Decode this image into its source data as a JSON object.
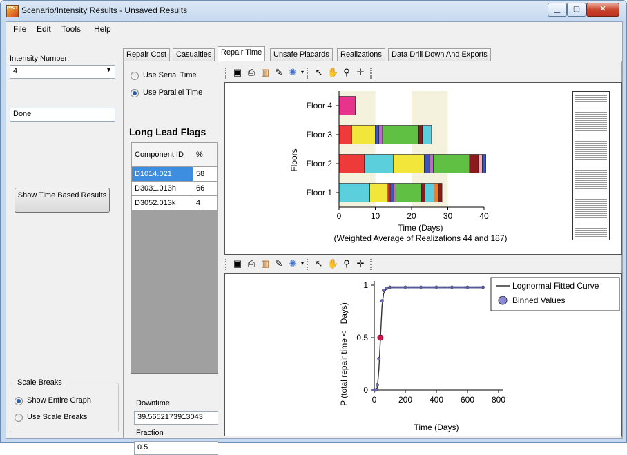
{
  "window": {
    "title": "Scenario/Intensity Results - Unsaved Results",
    "app_icon_text": "PACT"
  },
  "menu": [
    "File",
    "Edit",
    "Tools",
    "Help"
  ],
  "left": {
    "intensity_label": "Intensity Number:",
    "intensity_value": "4",
    "status": "Done",
    "show_time_button": "Show Time Based Results",
    "scale_breaks": {
      "legend": "Scale Breaks",
      "show_entire": "Show Entire Graph",
      "use_scale": "Use Scale Breaks",
      "selected": "show_entire"
    }
  },
  "tabs": [
    "Repair Cost",
    "Casualties",
    "Repair Time",
    "Unsafe Placards",
    "Realizations",
    "Data Drill Down And Exports"
  ],
  "active_tab": "Repair Time",
  "repair_time": {
    "use_serial": "Use Serial Time",
    "use_parallel": "Use Parallel Time",
    "selected": "parallel",
    "flags_title": "Long Lead Flags",
    "flags_headers": [
      "Component ID",
      "%"
    ],
    "flags_rows": [
      {
        "id": "D1014.021",
        "pct": "58"
      },
      {
        "id": "D3031.013h",
        "pct": "66"
      },
      {
        "id": "D3052.013k",
        "pct": "4"
      }
    ],
    "downtime_label": "Downtime",
    "downtime_value": "39.5652173913043",
    "fraction_label": "Fraction",
    "fraction_value": "0.5"
  },
  "toolbar_icons": [
    "chart-type-icon",
    "print-icon",
    "chart-data-icon",
    "chart-wizard-icon",
    "palette-icon",
    "pointer-icon",
    "pan-icon",
    "zoom-icon",
    "crosshair-icon"
  ],
  "chart_data": [
    {
      "type": "bar",
      "orientation": "horizontal-stacked",
      "ylabel": "Floors",
      "xlabel": "Time (Days)",
      "subtitle": "(Weighted Average of Realizations 44 and 187)",
      "categories": [
        "Floor 1",
        "Floor 2",
        "Floor 3",
        "Floor 4"
      ],
      "xlim": [
        0,
        40
      ],
      "xticks": [
        0,
        10,
        20,
        30,
        40
      ],
      "segments": {
        "Floor 1": [
          {
            "v": 8.5,
            "c": "#5bcfdc"
          },
          {
            "v": 5,
            "c": "#f2e63a"
          },
          {
            "v": 0.6,
            "c": "#ef3a3a"
          },
          {
            "v": 1,
            "c": "#3c55b8"
          },
          {
            "v": 0.6,
            "c": "#b96cc9"
          },
          {
            "v": 7,
            "c": "#5fc043"
          },
          {
            "v": 1,
            "c": "#8b1a1a"
          },
          {
            "v": 2.5,
            "c": "#5bcfdc"
          },
          {
            "v": 1.2,
            "c": "#f07f22"
          },
          {
            "v": 1,
            "c": "#8b1a1a"
          }
        ],
        "Floor 2": [
          {
            "v": 7,
            "c": "#ef3a3a"
          },
          {
            "v": 8,
            "c": "#5bcfdc"
          },
          {
            "v": 8.5,
            "c": "#f2e63a"
          },
          {
            "v": 1.5,
            "c": "#3c55b8"
          },
          {
            "v": 1,
            "c": "#b96cc9"
          },
          {
            "v": 10,
            "c": "#5fc043"
          },
          {
            "v": 2.5,
            "c": "#8b1a1a"
          },
          {
            "v": 1,
            "c": "#f7a9b8"
          },
          {
            "v": 1,
            "c": "#3c55b8"
          }
        ],
        "Floor 3": [
          {
            "v": 3.5,
            "c": "#ef3a3a"
          },
          {
            "v": 6.5,
            "c": "#f2e63a"
          },
          {
            "v": 1,
            "c": "#3c55b8"
          },
          {
            "v": 1,
            "c": "#b96cc9"
          },
          {
            "v": 10,
            "c": "#5fc043"
          },
          {
            "v": 1,
            "c": "#8b1a1a"
          },
          {
            "v": 2.5,
            "c": "#5bcfdc"
          }
        ],
        "Floor 4": [
          {
            "v": 4.5,
            "c": "#e8338c"
          }
        ]
      }
    },
    {
      "type": "line",
      "xlabel": "Time (Days)",
      "ylabel": "P (total repair time <= Days)",
      "xlim": [
        0,
        800
      ],
      "xticks": [
        0,
        200,
        400,
        600,
        800
      ],
      "ylim": [
        0,
        1
      ],
      "yticks": [
        0,
        0.5,
        1
      ],
      "series": [
        {
          "name": "Lognormal Fitted Curve",
          "x": [
            0,
            20,
            30,
            35,
            40,
            45,
            50,
            60,
            80,
            100,
            200,
            400,
            600,
            700
          ],
          "y": [
            0,
            0.02,
            0.2,
            0.35,
            0.5,
            0.65,
            0.8,
            0.92,
            0.97,
            0.98,
            0.98,
            0.98,
            0.98,
            0.98
          ]
        },
        {
          "name": "Binned Values",
          "x": [
            0,
            10,
            20,
            30,
            40,
            50,
            60,
            80,
            100,
            200,
            300,
            400,
            500,
            600,
            700
          ],
          "y": [
            0,
            0,
            0.05,
            0.3,
            0.5,
            0.85,
            0.95,
            0.97,
            0.98,
            0.98,
            0.98,
            0.98,
            0.98,
            0.98,
            0.98
          ]
        }
      ],
      "highlight_point": {
        "x": 39.57,
        "y": 0.5,
        "color": "#c8174e"
      },
      "legend": "top-right"
    }
  ]
}
